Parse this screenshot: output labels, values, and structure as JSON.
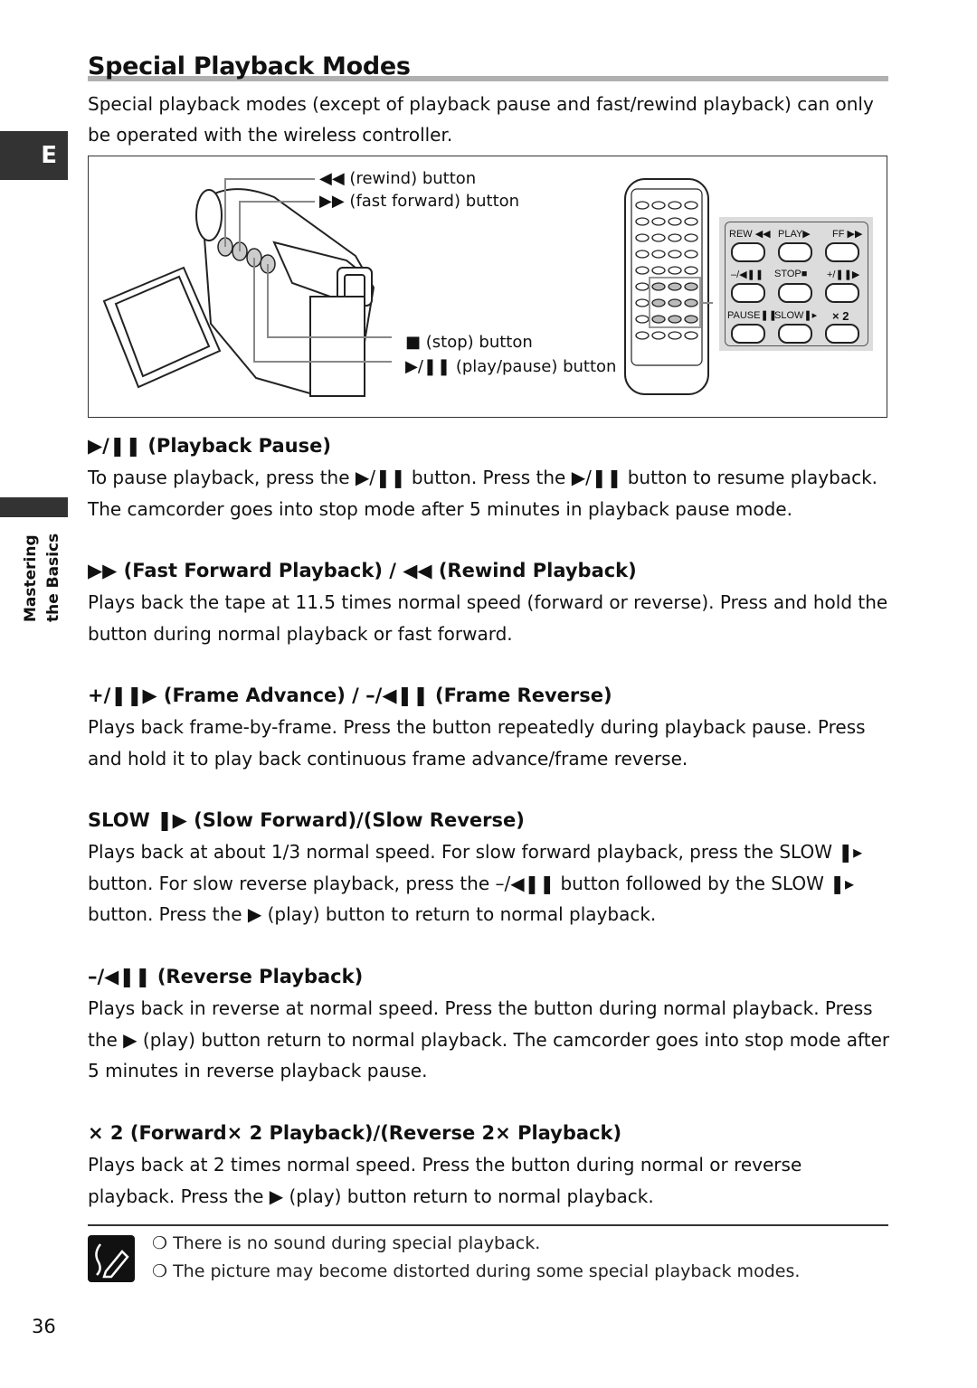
{
  "side_tab": {
    "letter": "E",
    "section_label_line1": "Mastering",
    "section_label_line2": "the Basics"
  },
  "page": {
    "title": "Special Playback Modes",
    "number": "36"
  },
  "intro": "Special playback modes (except of playback pause and fast/rewind playback) can only be operated with the wireless controller.",
  "figure": {
    "callouts": [
      {
        "symbol": "◀◀",
        "text": "(rewind) button"
      },
      {
        "symbol": "▶▶",
        "text": "(fast forward) button"
      },
      {
        "symbol": "■",
        "text": "(stop) button"
      },
      {
        "symbol": "▶/❚❚",
        "text": "(play/pause) button"
      }
    ],
    "remote_buttons": [
      {
        "label": "REW ◀◀"
      },
      {
        "label": "PLAY▶"
      },
      {
        "label": "FF ▶▶"
      },
      {
        "label": "–/◀❚❚"
      },
      {
        "label": "STOP■"
      },
      {
        "label": "+/❚❚▶"
      },
      {
        "label": "PAUSE❚❚"
      },
      {
        "label": "SLOW❚▸"
      },
      {
        "label": "× 2"
      }
    ]
  },
  "sections": [
    {
      "symbol": "▶/❚❚",
      "heading": "(Playback Pause)",
      "body": "To pause playback, press the ▶/❚❚ button. Press the ▶/❚❚ button to resume playback. The camcorder goes into stop mode after 5 minutes in playback pause mode."
    },
    {
      "symbol": "▶▶",
      "heading": "(Fast Forward Playback) / ◀◀ (Rewind Playback)",
      "body": "Plays back the tape at 11.5 times normal speed (forward or reverse). Press and hold the button during normal playback or fast forward."
    },
    {
      "symbol": "+/❚❚▶",
      "heading": "(Frame Advance) / –/◀❚❚ (Frame Reverse)",
      "body": "Plays back frame-by-frame. Press the button repeatedly during playback pause. Press and hold it to play back continuous frame advance/frame reverse."
    },
    {
      "symbol": "SLOW ❚▶",
      "heading": "(Slow Forward)/(Slow Reverse)",
      "body": "Plays back at about 1/3 normal speed. For slow forward playback, press the SLOW ❚▸ button. For slow reverse playback, press the –/◀❚❚ button followed by the SLOW ❚▸ button. Press the ▶ (play) button to return to normal playback."
    },
    {
      "symbol": "–/◀❚❚",
      "heading": "(Reverse Playback)",
      "body": "Plays back in reverse at normal speed. Press the button during normal playback. Press the ▶ (play) button return to normal playback. The camcorder goes into stop mode after 5 minutes in reverse playback pause."
    },
    {
      "symbol": "× 2",
      "heading": "(Forward× 2 Playback)/(Reverse 2× Playback)",
      "body": "Plays back at 2 times normal speed. Press the button during normal or reverse playback. Press the ▶ (play) button return to normal playback."
    }
  ],
  "notes": [
    "❍ There is no sound during special playback.",
    "❍ The picture may become distorted during some special playback modes."
  ]
}
